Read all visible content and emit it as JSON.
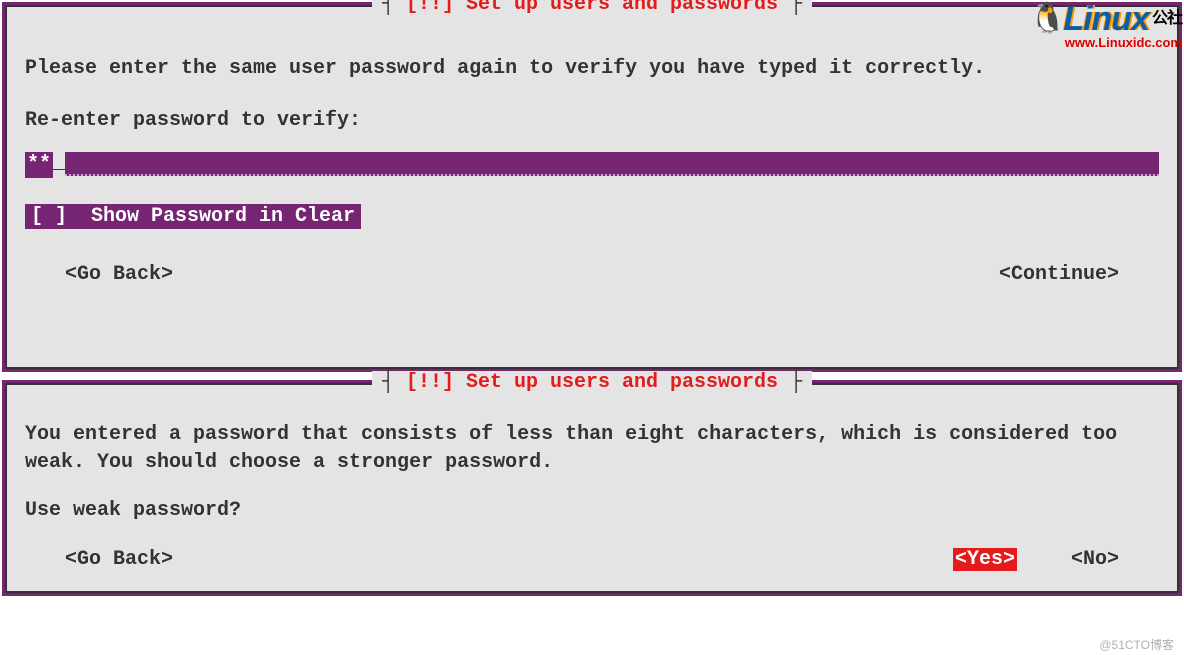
{
  "watermark": {
    "brand": "Linux",
    "suffix": "公社",
    "url": "www.Linuxidc.com",
    "tux": "🐧"
  },
  "dialog1": {
    "title_prefix": "┤ ",
    "title_marker": "[!!] ",
    "title_text": "Set up users and passwords",
    "title_suffix": " ├",
    "instruction": "Please enter the same user password again to verify you have typed it correctly.",
    "field_label": "Re-enter password to verify:",
    "password_value": "**",
    "show_clear": "[ ]  Show Password in Clear",
    "go_back": "<Go Back>",
    "continue": "<Continue>"
  },
  "dialog2": {
    "title_prefix": "┤ ",
    "title_marker": "[!!] ",
    "title_text": "Set up users and passwords",
    "title_suffix": " ├",
    "warning": "You entered a password that consists of less than eight characters, which is considered too weak. You should choose a stronger password.",
    "question": "Use weak password?",
    "go_back": "<Go Back>",
    "yes": "<Yes>",
    "no": "<No>"
  },
  "footer": "@51CTO博客"
}
